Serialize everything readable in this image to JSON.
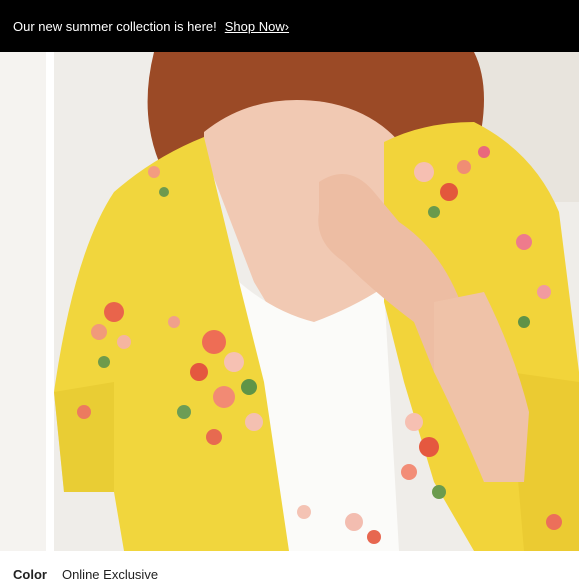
{
  "banner": {
    "message": "Our new summer collection is here!",
    "link_label": "Shop Now›"
  },
  "product": {
    "image_icon": "zoom-in-icon",
    "color_label": "Color",
    "color_value": "Online Exclusive"
  },
  "colors": {
    "banner_bg": "#000000",
    "kimono_yellow": "#f1d63d",
    "background": "#ffffff"
  }
}
